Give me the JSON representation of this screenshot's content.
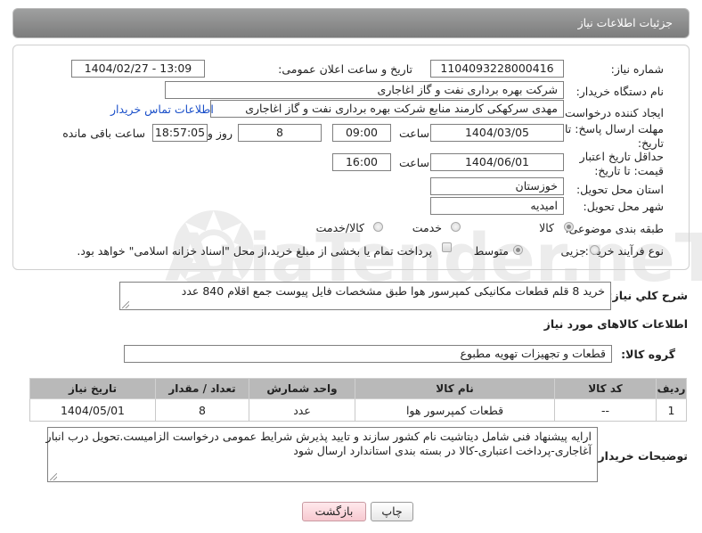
{
  "header": {
    "title": "جزئیات اطلاعات نیاز"
  },
  "watermark": {
    "brand": "AriaTender.neT"
  },
  "fields": {
    "need_number_label": "شماره نیاز:",
    "need_number": "1104093228000416",
    "announce_label": "تاریخ و ساعت اعلان عمومی:",
    "announce_value": "1404/02/27 - 13:09",
    "buyer_org_label": "نام دستگاه خریدار:",
    "buyer_org": "شرکت بهره برداری نفت و گاز اغاجاری",
    "creator_label": "ایجاد کننده درخواست:",
    "creator": "مهدی سرکهکی کارمند منابع شرکت بهره برداری نفت و گاز اغاجاری",
    "contact_link": "اطلاعات تماس خریدار",
    "deadline_label": "مهلت ارسال پاسخ: تا تاریخ:",
    "deadline_date": "1404/03/05",
    "time_label": "ساعت",
    "deadline_time": "09:00",
    "days_value": "8",
    "days_label": "روز و",
    "remaining_time": "18:57:05",
    "remaining_label": "ساعت باقی مانده",
    "validity_label": "حداقل تاریخ اعتبار قیمت: تا تاریخ:",
    "validity_date": "1404/06/01",
    "validity_time": "16:00",
    "province_label": "استان محل تحویل:",
    "province": "خوزستان",
    "city_label": "شهر محل تحویل:",
    "city": "امیدیه",
    "category_label": "طبقه بندی موضوعی:",
    "category_options": [
      "کالا",
      "خدمت",
      "کالا/خدمت"
    ],
    "process_label": "نوع فرآیند خرید :",
    "process_options": [
      "جزیی",
      "متوسط"
    ],
    "payment_note": "پرداخت تمام یا بخشی از مبلغ خرید،از محل \"اسناد خزانه اسلامی\" خواهد بود."
  },
  "description": {
    "label": "شرح کلي نياز:",
    "text": "خرید 8 قلم قطعات مکانیکی کمپرسور هوا طبق مشخصات فایل پیوست جمع اقلام 840 عدد"
  },
  "goods_info": {
    "title": "اطلاعات کالاهای مورد نیاز",
    "group_label": "گروه کالا:",
    "group_value": "قطعات و تجهیزات تهویه مطبوع"
  },
  "table": {
    "headers": [
      "ردیف",
      "کد کالا",
      "نام کالا",
      "واحد شمارش",
      "تعداد / مقدار",
      "تاریخ نیاز"
    ],
    "rows": [
      [
        "1",
        "--",
        "قطعات کمپرسور هوا",
        "عدد",
        "8",
        "1404/05/01"
      ]
    ]
  },
  "buyer_notes": {
    "label": "توضیحات خریدار:",
    "line1": "ارایه پیشنهاد فنی شامل دیتاشیت نام کشور سازند و تایید پذیرش شرایط عمومی درخواست الزامیست.تحویل درب انبار",
    "line2": "آغاجاری-پرداخت اعتباری-کالا در بسته بندی استاندارد ارسال شود"
  },
  "buttons": {
    "print": "چاپ",
    "back": "بازگشت"
  }
}
